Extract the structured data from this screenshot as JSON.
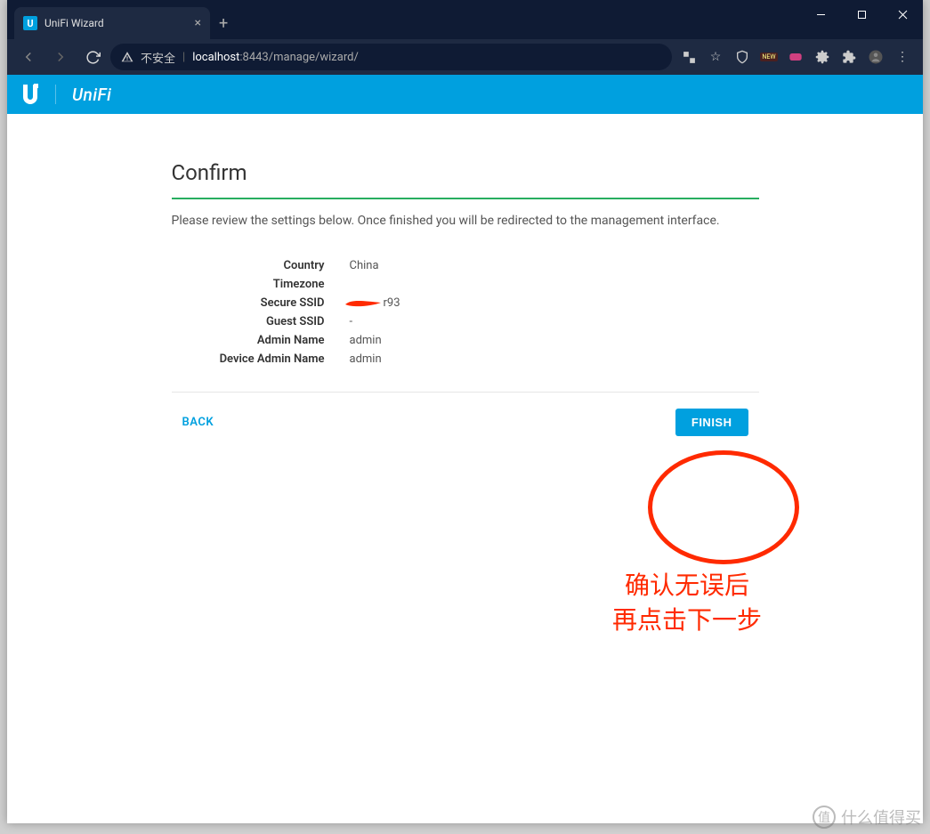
{
  "browser": {
    "tab_title": "UniFi Wizard",
    "insecure_label": "不安全",
    "url_host": "localhost",
    "url_port": ":8443",
    "url_path": "/manage/wizard/"
  },
  "header": {
    "brand": "UniFi"
  },
  "wizard": {
    "title": "Confirm",
    "instruction": "Please review the settings below. Once finished you will be redirected to the management interface.",
    "rows": [
      {
        "label": "Country",
        "value": "China"
      },
      {
        "label": "Timezone",
        "value": ""
      },
      {
        "label": "Secure SSID",
        "value": "r93"
      },
      {
        "label": "Guest SSID",
        "value": "-"
      },
      {
        "label": "Admin Name",
        "value": "admin"
      },
      {
        "label": "Device Admin Name",
        "value": "admin"
      }
    ],
    "back_label": "BACK",
    "finish_label": "FINISH"
  },
  "annotation": {
    "line1": "确认无误后",
    "line2": "再点击下一步"
  },
  "watermark": {
    "text": "什么值得买",
    "icon": "值"
  }
}
